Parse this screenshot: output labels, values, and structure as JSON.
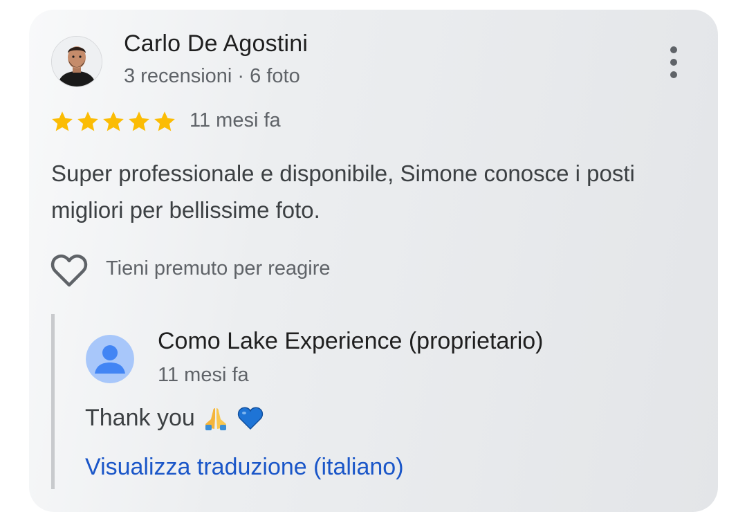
{
  "review": {
    "reviewer_name": "Carlo De Agostini",
    "reviewer_meta": "3 recensioni · 6 foto",
    "rating": 5,
    "rating_max": 5,
    "date": "11 mesi fa",
    "text": "Super professionale e disponibile, Simone conosce i posti migliori per bellissime foto.",
    "react_hint": "Tieni premuto per reagire"
  },
  "reply": {
    "owner_name": "Como Lake Experience (proprietario)",
    "date": "11 mesi fa",
    "text": "Thank you",
    "emojis": [
      "folded-hands-icon",
      "blue-heart-icon"
    ],
    "translate_link": "Visualizza traduzione (italiano)"
  },
  "colors": {
    "star": "#fbbc04",
    "link": "#1a56c8",
    "owner_avatar": "#a8c7fa"
  }
}
